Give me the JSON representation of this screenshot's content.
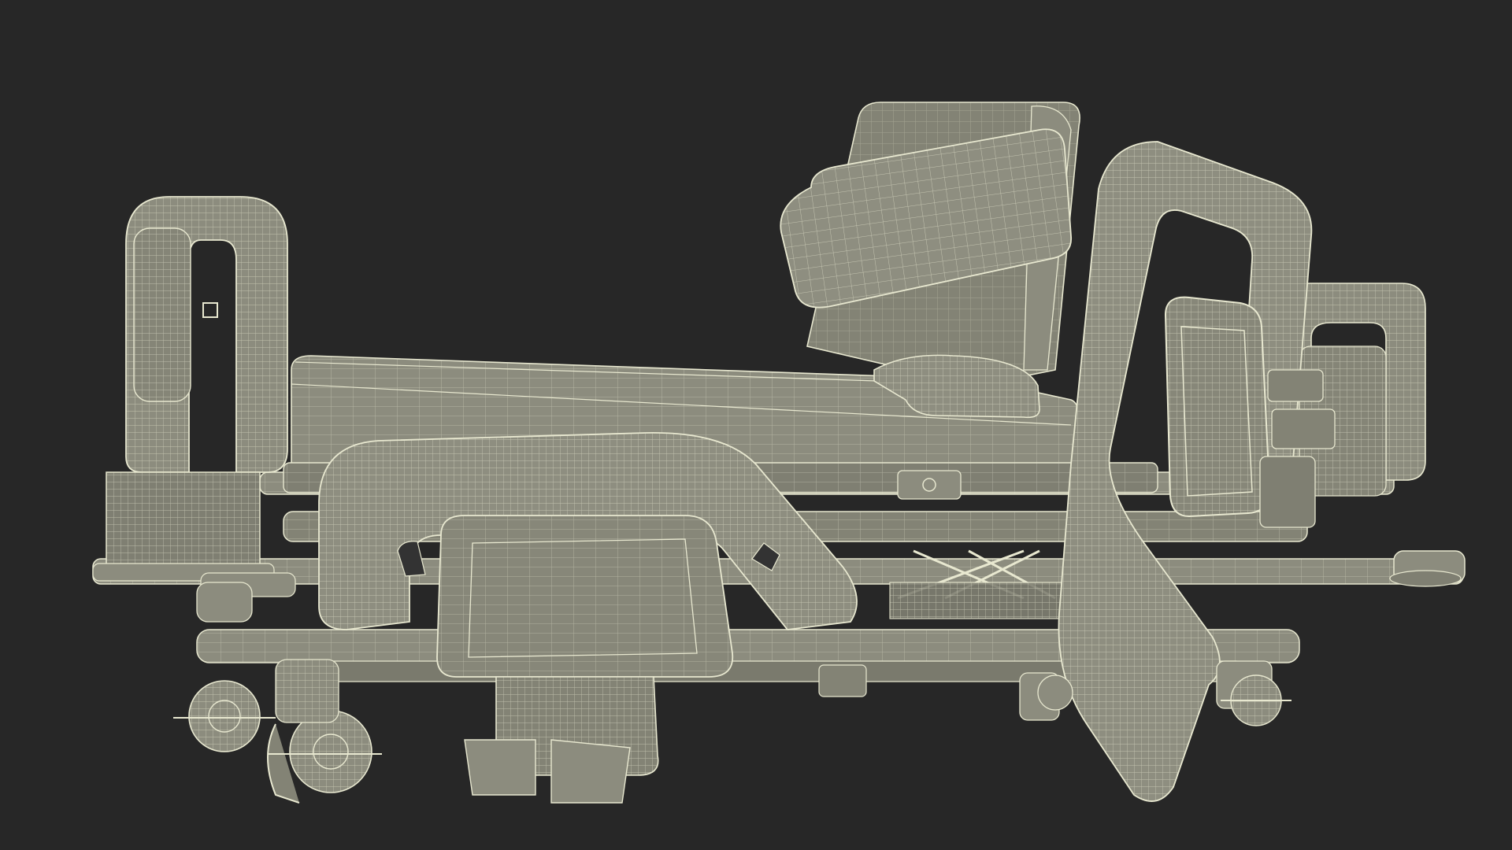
{
  "scene": {
    "subject": "hospital-bed-wireframe",
    "colors": {
      "background": "#272727",
      "surface": "#8c8c7e",
      "surface_dark": "#6f6f63",
      "surface_light": "#9a9a8b",
      "wire": "#e8e8d0",
      "wire_faint": "#cfcfb8"
    }
  }
}
